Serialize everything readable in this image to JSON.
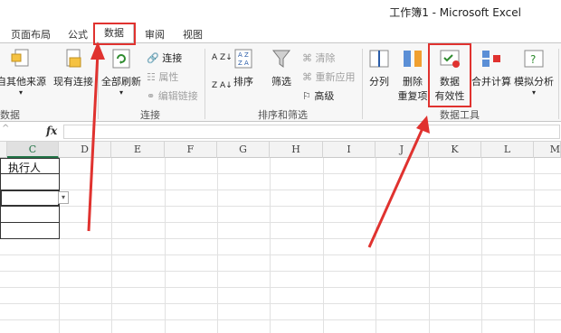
{
  "window": {
    "title": "工作簿1 - Microsoft Excel"
  },
  "tabs": [
    {
      "label": "页面布局"
    },
    {
      "label": "公式"
    },
    {
      "label": "数据",
      "active": true
    },
    {
      "label": "审阅"
    },
    {
      "label": "视图"
    }
  ],
  "ribbon": {
    "groups": {
      "external_data": "数据",
      "connections": "连接",
      "sort_filter": "排序和筛选",
      "data_tools": "数据工具"
    },
    "buttons": {
      "from_other_sources": "自其他来源",
      "existing_connections": "现有连接",
      "refresh_all": "全部刷新",
      "connections": "连接",
      "properties": "属性",
      "edit_links": "编辑链接",
      "sort": "排序",
      "filter": "筛选",
      "clear": "清除",
      "reapply": "重新应用",
      "advanced": "高级",
      "text_to_columns": "分列",
      "remove_dup_1": "删除",
      "remove_dup_2": "重复项",
      "validation_1": "数据",
      "validation_2": "有效性",
      "consolidate": "合并计算",
      "what_if": "模拟分析"
    },
    "sort_labels": {
      "az": "A Z",
      "za": "Z A"
    }
  },
  "formula_bar": {
    "fx": "fx",
    "name_box_fragment": "^",
    "value": ""
  },
  "columns": [
    "C",
    "D",
    "E",
    "F",
    "G",
    "H",
    "I",
    "J",
    "K",
    "L",
    "M"
  ],
  "selected_column": "C",
  "cells": {
    "C1": "执行人"
  },
  "annotation_color": "#e0322f"
}
